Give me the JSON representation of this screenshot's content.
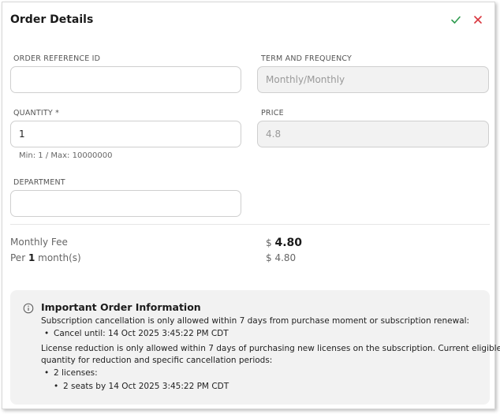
{
  "header": {
    "title": "Order Details",
    "confirm_icon": "check-icon",
    "close_icon": "close-icon"
  },
  "form": {
    "order_reference": {
      "label": "ORDER REFERENCE ID",
      "value": "",
      "placeholder": ""
    },
    "term_frequency": {
      "label": "TERM AND FREQUENCY",
      "value": "Monthly/Monthly"
    },
    "quantity": {
      "label": "QUANTITY *",
      "value": "1",
      "hint": "Min: 1 / Max: 10000000"
    },
    "price": {
      "label": "PRICE",
      "value": "4.8"
    },
    "department": {
      "label": "DEPARTMENT",
      "value": "",
      "placeholder": ""
    }
  },
  "fees": {
    "monthly_label": "Monthly Fee",
    "monthly_currency": "$",
    "monthly_value": "4.80",
    "per_prefix": "Per",
    "per_count": "1",
    "per_suffix": "month(s)",
    "per_currency": "$",
    "per_value": "4.80"
  },
  "info": {
    "icon": "info-icon",
    "title": "Important Order Information",
    "cancellation_text": "Subscription cancellation is only allowed within 7 days from purchase moment or subscription renewal:",
    "cancel_until": "Cancel until: 14 Oct 2025 3:45:22 PM CDT",
    "reduction_line1": "License reduction is only allowed within 7 days of purchasing new licenses on the subscription. Current eligible",
    "reduction_line2": "quantity for reduction and specific cancellation periods:",
    "licenses": "2 licenses:",
    "seats": "2 seats by 14 Oct 2025 3:45:22 PM CDT"
  },
  "colors": {
    "confirm": "#2e9b4f",
    "close": "#d9363e",
    "readonly_bg": "#f2f2f2",
    "info_bg": "#f2f2f2"
  }
}
